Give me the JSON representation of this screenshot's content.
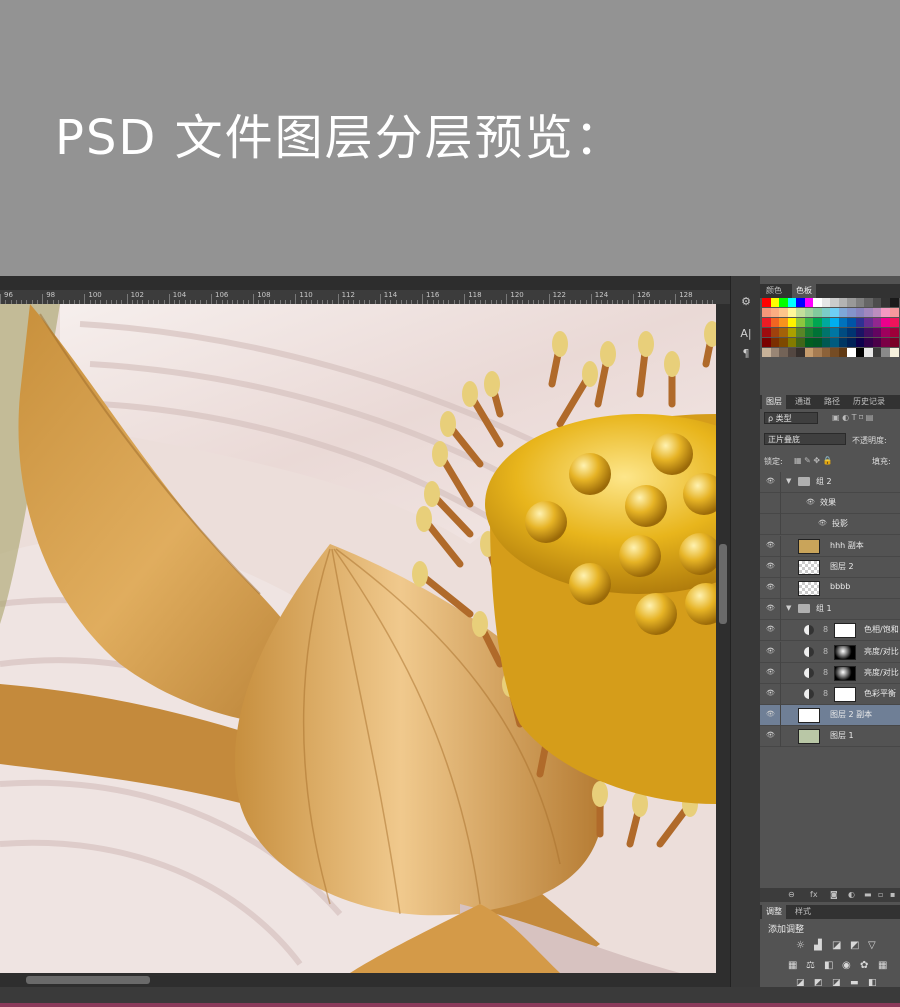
{
  "banner": {
    "title": "PSD 文件图层分层预览："
  },
  "ruler": {
    "labels": [
      "96",
      "98",
      "100",
      "102",
      "104",
      "106",
      "108",
      "110",
      "112",
      "114",
      "116",
      "118",
      "120",
      "122",
      "124",
      "126",
      "128"
    ]
  },
  "tools": {
    "icons": [
      "brush-preset-icon",
      "character-icon",
      "paragraph-icon"
    ],
    "glyphs": [
      "⚙",
      "A|",
      "¶"
    ]
  },
  "color_panel": {
    "tabs": [
      "颜色",
      "色板"
    ],
    "active_tab": "色板",
    "swatch_colors": [
      [
        "#ff0000",
        "#ffff00",
        "#00ff00",
        "#00ffff",
        "#0000ff",
        "#ff00ff",
        "#ffffff",
        "#e6e6e6",
        "#cccccc",
        "#b3b3b3",
        "#999999",
        "#808080",
        "#666666",
        "#4d4d4d",
        "#333333",
        "#1a1a1a"
      ],
      [
        "#f7977a",
        "#fbad82",
        "#fdc68c",
        "#fff79a",
        "#c4df9b",
        "#a2d39c",
        "#82ca9d",
        "#7bcdc8",
        "#6ecff6",
        "#7ea7d8",
        "#8493ca",
        "#8882be",
        "#a187be",
        "#bc8dbf",
        "#f49ac2",
        "#f6989d"
      ],
      [
        "#ed1c24",
        "#f26522",
        "#f7941d",
        "#fff200",
        "#8dc63f",
        "#39b54a",
        "#00a651",
        "#00a99d",
        "#00aeef",
        "#0072bc",
        "#0054a6",
        "#2e3192",
        "#662d91",
        "#92278f",
        "#ec008c",
        "#ed145b"
      ],
      [
        "#9e0b0f",
        "#a0410d",
        "#a36209",
        "#aba000",
        "#598527",
        "#1a7b30",
        "#007236",
        "#00746b",
        "#0076a3",
        "#004b80",
        "#003471",
        "#1b1464",
        "#440e62",
        "#630460",
        "#9e005d",
        "#9e0039"
      ],
      [
        "#790000",
        "#7b2e00",
        "#7d4900",
        "#827b00",
        "#406618",
        "#005e20",
        "#005826",
        "#005952",
        "#005b7f",
        "#003663",
        "#002157",
        "#0d004c",
        "#32004b",
        "#4b0049",
        "#7b0046",
        "#7a0026"
      ],
      [
        "#c7b299",
        "#998675",
        "#736357",
        "#534741",
        "#37302d",
        "#c69c6d",
        "#a67c52",
        "#8c6239",
        "#754c24",
        "#603913",
        "#ffffff",
        "#000000",
        "#e8e8e8",
        "#3b3b3b",
        "#8a8a8a",
        "#f5f0dc"
      ]
    ]
  },
  "layers_panel": {
    "tabs": [
      "图层",
      "通道",
      "路径",
      "历史记录"
    ],
    "active_tab": "图层",
    "filter_label": "ρ 类型",
    "blend_mode": "正片叠底",
    "opacity_label": "不透明度:",
    "lock_label": "锁定:",
    "fill_label": "填充:",
    "layers": [
      {
        "name": "组 2",
        "kind": "group",
        "expanded": true,
        "indent": 0
      },
      {
        "name": "效果",
        "kind": "effects",
        "indent": 1
      },
      {
        "name": "投影",
        "kind": "effect",
        "indent": 2
      },
      {
        "name": "hhh 副本",
        "kind": "pixel",
        "thumb": "#c9a45a",
        "indent": 0
      },
      {
        "name": "图层 2",
        "kind": "pixel",
        "thumb": "transparent",
        "indent": 0
      },
      {
        "name": "bbbb",
        "kind": "pixel",
        "thumb": "transparent",
        "indent": 0
      },
      {
        "name": "组 1",
        "kind": "group",
        "expanded": true,
        "indent": 0
      },
      {
        "name": "色相/饱和",
        "kind": "adjustment",
        "thumb": "#ffffff",
        "indent": 1
      },
      {
        "name": "亮度/对比",
        "kind": "adjustment",
        "thumb": "#000000",
        "indent": 1
      },
      {
        "name": "亮度/对比",
        "kind": "adjustment",
        "thumb": "#111111",
        "indent": 1
      },
      {
        "name": "色彩平衡",
        "kind": "adjustment",
        "thumb": "#ffffff",
        "indent": 1
      },
      {
        "name": "图层 2 副本",
        "kind": "pixel",
        "thumb": "#ffffff",
        "selected": true,
        "indent": 0
      },
      {
        "name": "图层 1",
        "kind": "pixel",
        "thumb": "#b9c7a6",
        "indent": 0
      }
    ]
  },
  "adjust_panel": {
    "tabs": [
      "调整",
      "样式"
    ],
    "active_tab": "调整",
    "title": "添加调整"
  }
}
